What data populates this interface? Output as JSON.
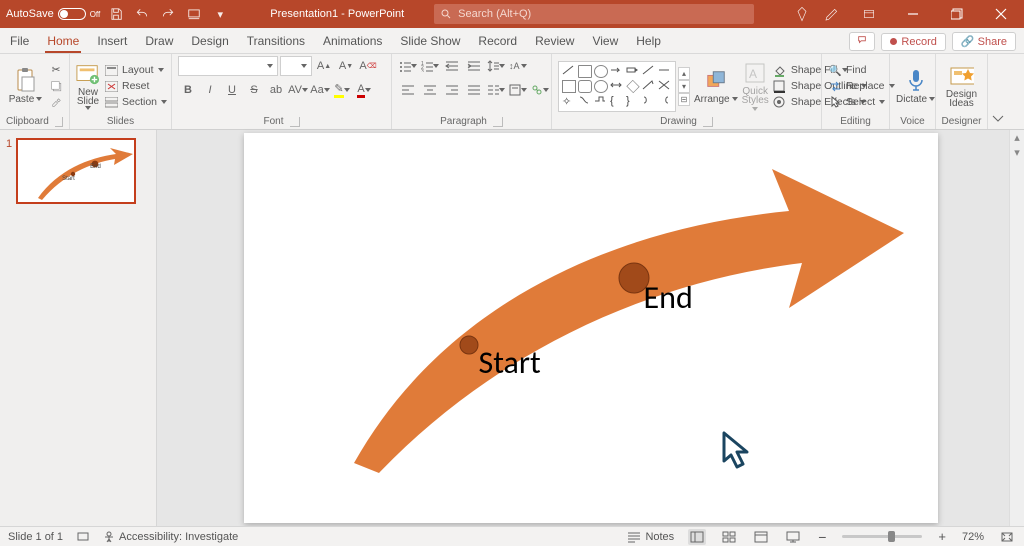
{
  "title": {
    "autosave": "AutoSave",
    "autosave_state": "Off",
    "doc": "Presentation1 - PowerPoint",
    "search_placeholder": "Search (Alt+Q)"
  },
  "tabs": {
    "file": "File",
    "home": "Home",
    "insert": "Insert",
    "draw": "Draw",
    "design": "Design",
    "transitions": "Transitions",
    "animations": "Animations",
    "slideshow": "Slide Show",
    "record": "Record",
    "review": "Review",
    "view": "View",
    "help": "Help"
  },
  "actions": {
    "comments_tip": "Comments",
    "record": "Record",
    "share": "Share"
  },
  "groups": {
    "clipboard": "Clipboard",
    "slides": "Slides",
    "font": "Font",
    "paragraph": "Paragraph",
    "drawing": "Drawing",
    "editing": "Editing",
    "voice": "Voice",
    "designer": "Designer"
  },
  "clipboard": {
    "paste": "Paste"
  },
  "slides": {
    "new_slide": "New Slide",
    "layout": "Layout",
    "reset": "Reset",
    "section": "Section"
  },
  "font": {
    "font_placeholder": "",
    "size_placeholder": "",
    "bold": "B",
    "italic": "I",
    "underline": "U",
    "strike": "S"
  },
  "drawing": {
    "arrange": "Arrange",
    "quick": "Quick Styles",
    "shape_fill": "Shape Fill",
    "shape_outline": "Shape Outline",
    "shape_effects": "Shape Effects"
  },
  "editing": {
    "find": "Find",
    "replace": "Replace",
    "select": "Select"
  },
  "voice": {
    "dictate": "Dictate"
  },
  "designer": {
    "design_ideas": "Design Ideas"
  },
  "status": {
    "slide": "Slide 1 of 1",
    "accessibility": "Accessibility: Investigate",
    "notes": "Notes",
    "zoom": "72%"
  },
  "canvas": {
    "start": "Start",
    "end": "End"
  },
  "thumb": {
    "num": "1"
  }
}
